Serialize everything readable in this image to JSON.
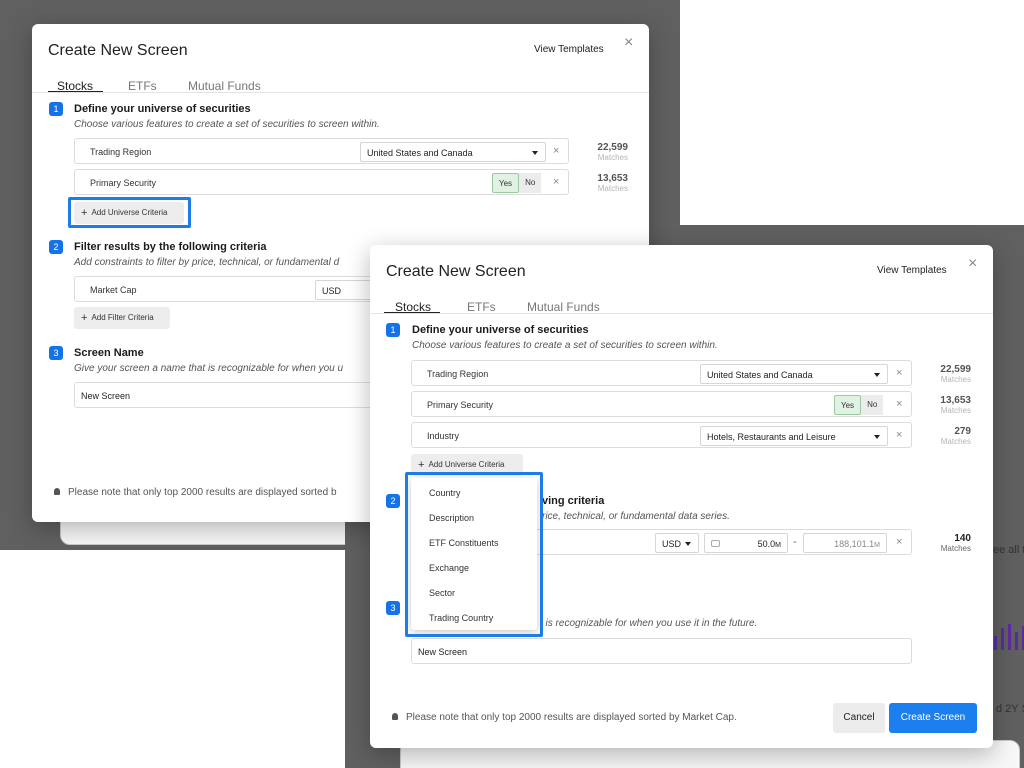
{
  "back_modal": {
    "title": "Create New Screen",
    "view_templates": "View Templates",
    "close": "×",
    "tabs": [
      "Stocks",
      "ETFs",
      "Mutual Funds"
    ],
    "section1": {
      "number": "1",
      "title": "Define your universe of securities",
      "desc": "Choose various features to create a set of securities to screen within."
    },
    "rows": [
      {
        "label": "Trading Region",
        "select": "United States and Canada",
        "matches": "22,599",
        "matches_label": "Matches"
      },
      {
        "label": "Primary Security",
        "yes": "Yes",
        "no": "No",
        "matches": "13,653",
        "matches_label": "Matches"
      }
    ],
    "add_universe": "Add Universe Criteria",
    "section2": {
      "number": "2",
      "title": "Filter results by the following criteria",
      "desc": "Add constraints to filter by price, technical, or fundamental d"
    },
    "filter_row": {
      "label": "Market Cap",
      "currency": "USD"
    },
    "add_filter": "Add Filter Criteria",
    "section3": {
      "number": "3",
      "title": "Screen Name",
      "desc": "Give your screen a name that is recognizable for when you u"
    },
    "screen_name_value": "New Screen",
    "note": "Please note that only top 2000 results are displayed sorted b"
  },
  "front_modal": {
    "title": "Create New Screen",
    "view_templates": "View Templates",
    "close": "×",
    "tabs": [
      "Stocks",
      "ETFs",
      "Mutual Funds"
    ],
    "section1": {
      "number": "1",
      "title": "Define your universe of securities",
      "desc": "Choose various features to create a set of securities to screen within."
    },
    "rows": [
      {
        "label": "Trading Region",
        "select": "United States and Canada",
        "matches": "22,599",
        "matches_label": "Matches"
      },
      {
        "label": "Primary Security",
        "yes": "Yes",
        "no": "No",
        "matches": "13,653",
        "matches_label": "Matches"
      },
      {
        "label": "Industry",
        "select": "Hotels, Restaurants and Leisure",
        "matches": "279",
        "matches_label": "Matches"
      }
    ],
    "add_universe": "Add Universe Criteria",
    "section2": {
      "number": "2",
      "title_visible": "ving criteria",
      "desc_visible": "rice, technical, or fundamental data series."
    },
    "filter_row": {
      "currency": "USD",
      "min": "50.0",
      "min_unit": "M",
      "dash": "-",
      "max": "188,101.1",
      "max_unit": "M",
      "matches": "140",
      "matches_label": "Matches"
    },
    "section3": {
      "number": "3",
      "desc_visible": "t is recognizable for when you use it in the future."
    },
    "screen_name_value": "New Screen",
    "note": "Please note that only top 2000 results are displayed sorted by Market Cap.",
    "cancel": "Cancel",
    "create": "Create Screen"
  },
  "dropdown": {
    "items": [
      "Country",
      "Description",
      "ETF Constituents",
      "Exchange",
      "Sector",
      "Trading Country"
    ]
  },
  "background": {
    "right_text_1": "ee all te",
    "right_text_2": "d 2Y Sa"
  },
  "colors": {
    "accent": "#1b7ff0",
    "highlight": "#1e7ce8",
    "backdrop": "#606060"
  }
}
